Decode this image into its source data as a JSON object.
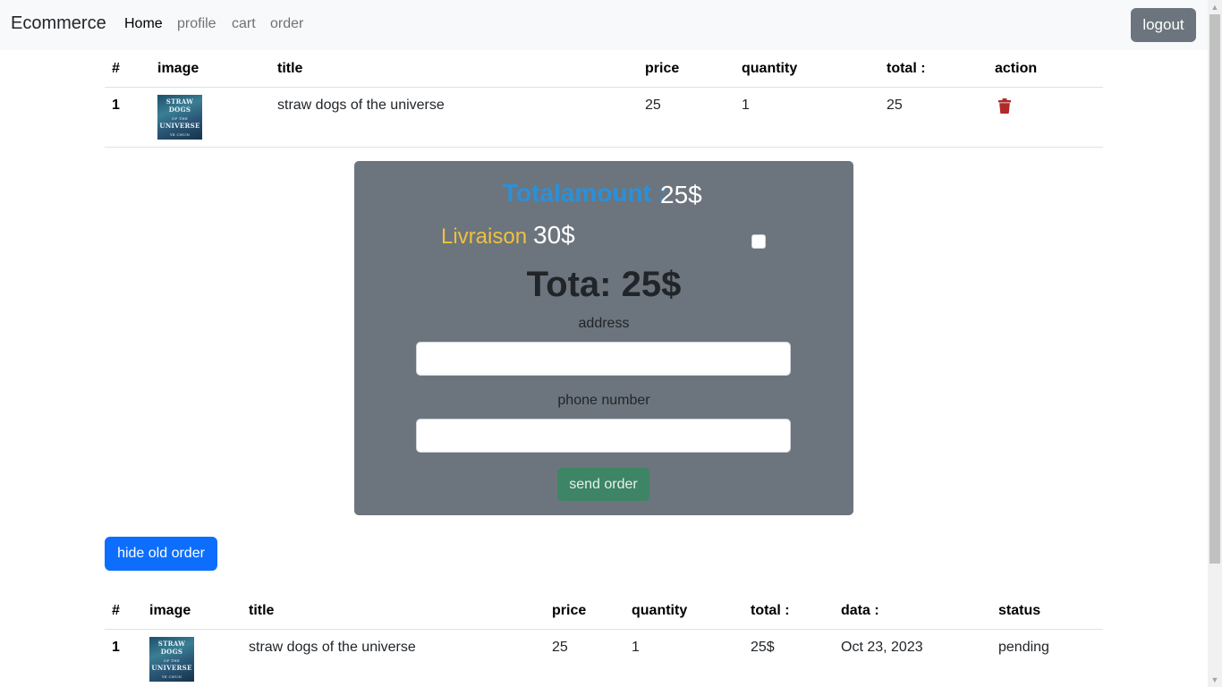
{
  "navbar": {
    "brand": "Ecommerce",
    "links": [
      {
        "label": "Home",
        "active": true
      },
      {
        "label": "profile",
        "active": false
      },
      {
        "label": "cart",
        "active": false
      },
      {
        "label": "order",
        "active": false
      }
    ],
    "logout_label": "logout"
  },
  "cart_table": {
    "headers": [
      "#",
      "image",
      "title",
      "price",
      "quantity",
      "total :",
      "action"
    ],
    "rows": [
      {
        "index": "1",
        "image_text": "STRAW DOGS OF THE UNIVERSE",
        "title": "straw dogs of the universe",
        "price": "25",
        "quantity": "1",
        "total": "25",
        "action_icon": "trash-icon"
      }
    ]
  },
  "order_panel": {
    "total_amount_label": "Totalamount :",
    "total_amount_value": "25$",
    "delivery_label": "Livraison",
    "delivery_value": "30$",
    "delivery_checked": false,
    "grand_total": "Tota: 25$",
    "address_label": "address",
    "address_value": "",
    "phone_label": "phone number",
    "phone_value": "",
    "send_label": "send order"
  },
  "hide_button_label": "hide old order",
  "old_orders_table": {
    "headers": [
      "#",
      "image",
      "title",
      "price",
      "quantity",
      "total :",
      "data :",
      "status"
    ],
    "rows": [
      {
        "index": "1",
        "image_text": "STRAW DOGS OF THE UNIVERSE",
        "title": "straw dogs of the universe",
        "price": "25",
        "quantity": "1",
        "total": "25$",
        "date": "Oct 23, 2023",
        "status": "pending"
      }
    ]
  },
  "colors": {
    "navbar_bg": "#f8f9fa",
    "panel_bg": "#6c757d",
    "total_label": "#2b90d9",
    "delivery_label": "#f0c040",
    "send_button": "#3d8564",
    "primary_button": "#0d6efd",
    "trash": "#b02a2a"
  }
}
